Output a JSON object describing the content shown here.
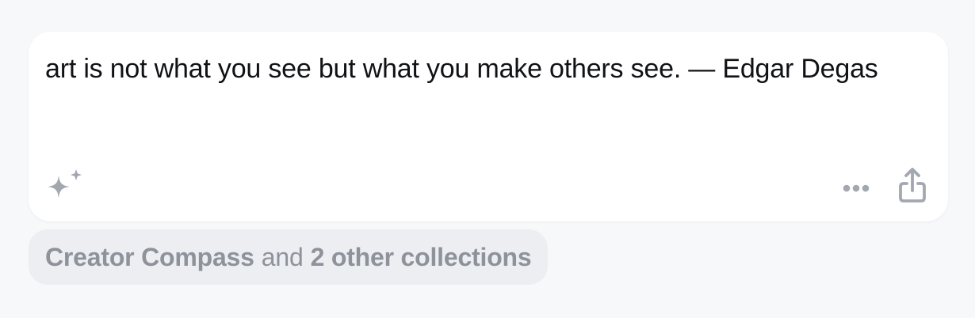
{
  "note": {
    "quote": "art is not what you see but what you make others see. — Edgar Degas",
    "icons": {
      "sparkle": "sparkle-icon",
      "more": "more-horizontal-icon",
      "share": "share-icon"
    }
  },
  "collections": {
    "primary": "Creator Compass",
    "connector": "and",
    "others": "2 other collections"
  },
  "colors": {
    "background": "#f7f8fa",
    "card": "#ffffff",
    "icon": "#a3a7b0",
    "chip_background": "#eceef1",
    "chip_text": "#8d929b",
    "text": "#111216"
  }
}
